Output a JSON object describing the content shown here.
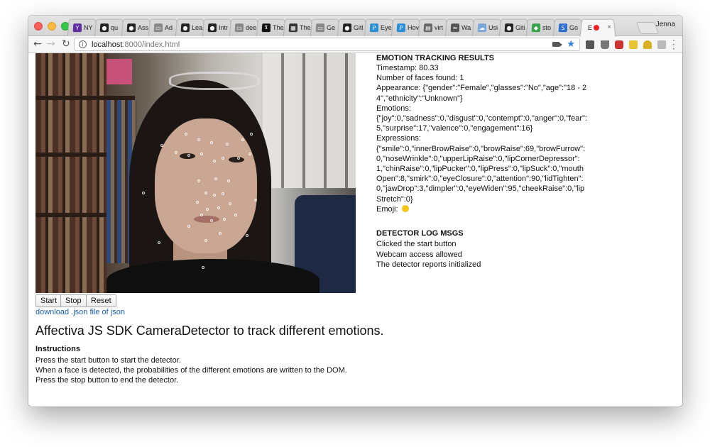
{
  "browser": {
    "profile_name": "Jenna",
    "url_host": "localhost",
    "url_rest": ":8000/index.html",
    "tabs": [
      {
        "label": "NY",
        "icon": "yahoo-icon",
        "color": "#5f2da0"
      },
      {
        "label": "qu",
        "icon": "github-icon",
        "color": "#222222"
      },
      {
        "label": "Ass",
        "icon": "github-icon",
        "color": "#222222"
      },
      {
        "label": "Ad",
        "icon": "document-icon",
        "color": "#888888"
      },
      {
        "label": "Lea",
        "icon": "circle-logo-icon",
        "color": "#222222"
      },
      {
        "label": "Intr",
        "icon": "github-icon",
        "color": "#222222"
      },
      {
        "label": "dee",
        "icon": "document-icon",
        "color": "#888888"
      },
      {
        "label": "The",
        "icon": "nyt-icon",
        "color": "#111111"
      },
      {
        "label": "The",
        "icon": "grid-logo-icon",
        "color": "#333333"
      },
      {
        "label": "Ge",
        "icon": "document-icon",
        "color": "#888888"
      },
      {
        "label": "Gitl",
        "icon": "github-icon",
        "color": "#222222"
      },
      {
        "label": "Eye",
        "icon": "p-logo-icon",
        "color": "#2b8fd6"
      },
      {
        "label": "Hov",
        "icon": "p-logo-icon",
        "color": "#2b8fd6"
      },
      {
        "label": "virt",
        "icon": "grid-icon",
        "color": "#666666"
      },
      {
        "label": "Wa",
        "icon": "soundwave-icon",
        "color": "#555555"
      },
      {
        "label": "Usi",
        "icon": "cloud-icon",
        "color": "#7aa7d9"
      },
      {
        "label": "Giti",
        "icon": "github-icon",
        "color": "#222222"
      },
      {
        "label": "sto",
        "icon": "diamond-logo-icon",
        "color": "#37a34a"
      },
      {
        "label": "Go",
        "icon": "s-logo-icon",
        "color": "#2f6fd0"
      },
      {
        "label": "E",
        "icon": "recording-icon",
        "color": "#e22222",
        "active": true
      }
    ]
  },
  "controls": {
    "start_label": "Start",
    "stop_label": "Stop",
    "reset_label": "Reset",
    "download_link": "download .json file of json"
  },
  "page": {
    "title": "Affectiva JS SDK CameraDetector to track different emotions.",
    "instructions_heading": "Instructions",
    "instructions": [
      "Press the start button to start the detector.",
      "When a face is detected, the probabilities of the different emotions are written to the DOM.",
      "Press the stop button to end the detector."
    ]
  },
  "results": {
    "heading": "EMOTION TRACKING RESULTS",
    "timestamp": "Timestamp: 80.33",
    "faces": "Number of faces found: 1",
    "appearance": "Appearance: {\"gender\":\"Female\",\"glasses\":\"No\",\"age\":\"18 - 24\",\"ethnicity\":\"Unknown\"}",
    "emotions_label": "Emotions:",
    "emotions": "{\"joy\":0,\"sadness\":0,\"disgust\":0,\"contempt\":0,\"anger\":0,\"fear\":5,\"surprise\":17,\"valence\":0,\"engagement\":16}",
    "expressions_label": "Expressions:",
    "expressions": "{\"smile\":0,\"innerBrowRaise\":0,\"browRaise\":69,\"browFurrow\":0,\"noseWrinkle\":0,\"upperLipRaise\":0,\"lipCornerDepressor\":1,\"chinRaise\":0,\"lipPucker\":0,\"lipPress\":0,\"lipSuck\":0,\"mouthOpen\":8,\"smirk\":0,\"eyeClosure\":0,\"attention\":90,\"lidTighten\":0,\"jawDrop\":3,\"dimpler\":0,\"eyeWiden\":95,\"cheekRaise\":0,\"lipStretch\":0}",
    "emoji_label": "Emoji:"
  },
  "log": {
    "heading": "DETECTOR LOG MSGS",
    "messages": [
      "Clicked the start button",
      "Webcam access allowed",
      "The detector reports initialized"
    ]
  }
}
